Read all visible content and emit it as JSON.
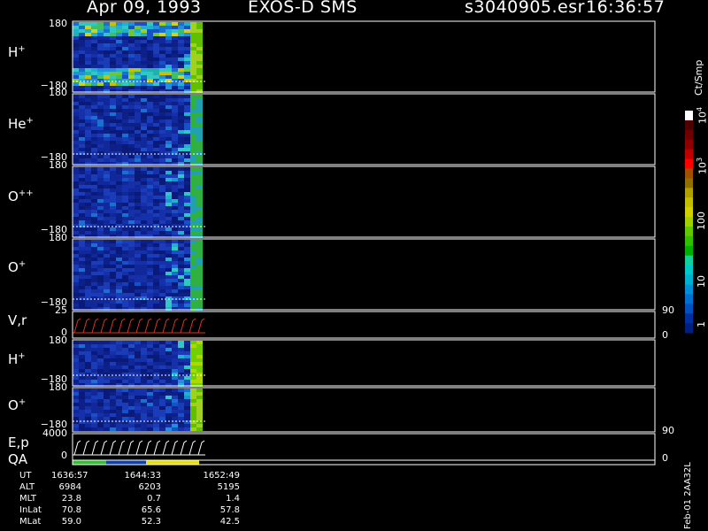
{
  "header": {
    "date": "Apr 09, 1993",
    "mission": "EXOS-D SMS",
    "file": "s3040905.esr",
    "time": "16:36:57"
  },
  "colorbar": {
    "units": "Ct/Smp",
    "ticks": [
      "1",
      "10",
      "100",
      "10",
      "10"
    ],
    "ticks_sup": [
      "",
      "",
      "",
      "3",
      "4"
    ],
    "colors": [
      "#002080",
      "#0030a0",
      "#0050c0",
      "#0070d0",
      "#0090d8",
      "#00b0d0",
      "#00c8c8",
      "#10d0a0",
      "#00b000",
      "#30c000",
      "#60c800",
      "#a0d000",
      "#d0d000",
      "#c0c000",
      "#b0a000",
      "#907000",
      "#a05000",
      "#ff0000",
      "#c00000",
      "#900000",
      "#700000",
      "#500000",
      "#ffffff"
    ]
  },
  "panels": [
    {
      "label": "H",
      "sup": "+",
      "top": "180",
      "bottom": "−180"
    },
    {
      "label": "He",
      "sup": "+",
      "top": "180",
      "bottom": "−180"
    },
    {
      "label": "O",
      "sup": "++",
      "top": "180",
      "bottom": "−180"
    },
    {
      "label": "O",
      "sup": "+",
      "top": "180",
      "bottom": "−180"
    },
    {
      "label": "V,r",
      "sup": "",
      "top": "25",
      "bottom": "0",
      "right_top": "90",
      "right_bottom": "0"
    },
    {
      "label": "H",
      "sup": "+",
      "top": "180",
      "bottom": "−180"
    },
    {
      "label": "O",
      "sup": "+",
      "top": "180",
      "bottom": "−180"
    },
    {
      "label": "E,p",
      "sup": "",
      "top": "4000",
      "bottom": "0",
      "right_top": "90",
      "right_bottom": "0"
    },
    {
      "label": "QA",
      "sup": "",
      "top": "",
      "bottom": ""
    }
  ],
  "orbit_table": {
    "rows": [
      {
        "label": "UT",
        "values": [
          "1636:57",
          "1644:33",
          "1652:49"
        ]
      },
      {
        "label": "ALT",
        "values": [
          "6984",
          "6203",
          "5195"
        ]
      },
      {
        "label": "MLT",
        "values": [
          "23.8",
          "0.7",
          "1.4"
        ]
      },
      {
        "label": "InLat",
        "values": [
          "70.8",
          "65.6",
          "57.8"
        ]
      },
      {
        "label": "MLat",
        "values": [
          "59.0",
          "52.3",
          "42.5"
        ]
      }
    ]
  },
  "footer_id": "Feb-01  2AA32L",
  "chart_data": {
    "type": "heatmap",
    "title": "Apr 09, 1993   EXOS-D SMS",
    "x": [
      "1636:57",
      "1644:33",
      "1652:49"
    ],
    "ylim": [
      -180,
      180
    ],
    "series": [
      {
        "name": "H+",
        "ylim": [
          -180,
          180
        ]
      },
      {
        "name": "He+",
        "ylim": [
          -180,
          180
        ]
      },
      {
        "name": "O++",
        "ylim": [
          -180,
          180
        ]
      },
      {
        "name": "O+",
        "ylim": [
          -180,
          180
        ]
      },
      {
        "name": "V,r",
        "ylim": [
          0,
          25
        ],
        "right_ylim": [
          0,
          90
        ]
      },
      {
        "name": "H+",
        "ylim": [
          -180,
          180
        ]
      },
      {
        "name": "O+",
        "ylim": [
          -180,
          180
        ]
      },
      {
        "name": "E,p",
        "ylim": [
          0,
          4000
        ],
        "right_ylim": [
          0,
          90
        ]
      }
    ],
    "colorbar_label": "Ct/Smp",
    "colorbar_scale": "log",
    "colorbar_range": [
      1,
      10000
    ]
  }
}
